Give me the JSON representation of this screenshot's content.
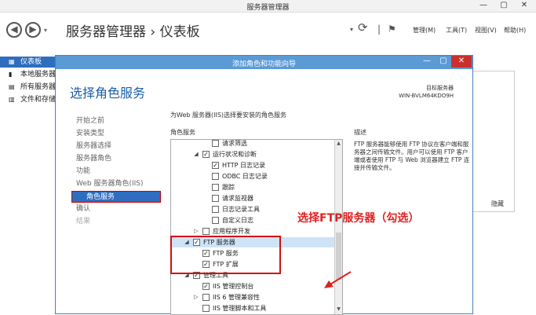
{
  "window": {
    "title": "服务器管理器",
    "min": "—",
    "max": "▢",
    "close": "✕"
  },
  "header": {
    "back": "◀",
    "forward": "▶",
    "dropdown": "▾",
    "breadcrumb": "服务器管理器 › 仪表板",
    "refresh_dd": "▾",
    "refresh": "⟳",
    "divider": "|",
    "flag": "⚑",
    "menus": [
      "管理(M)",
      "工具(T)",
      "视图(V)",
      "帮助(H)"
    ]
  },
  "sidebar": {
    "items": [
      {
        "label": "仪表板",
        "icon": "dashboard-icon",
        "glyph": "▦",
        "active": true
      },
      {
        "label": "本地服务器",
        "icon": "server-icon",
        "glyph": "▮",
        "active": false
      },
      {
        "label": "所有服务器",
        "icon": "servers-icon",
        "glyph": "▤",
        "active": false
      },
      {
        "label": "文件和存储",
        "icon": "storage-icon",
        "glyph": "▥",
        "active": false
      }
    ]
  },
  "bg": {
    "hide": "隐藏"
  },
  "dialog": {
    "title": "添加角色和功能向导",
    "btn_min": "—",
    "btn_max": "▢",
    "btn_close": "✕",
    "heading": "选择角色服务",
    "target_label": "目标服务器",
    "target_value": "WIN-BVLM64KDO9H",
    "steps": [
      {
        "label": "开始之前",
        "state": "normal"
      },
      {
        "label": "安装类型",
        "state": "normal"
      },
      {
        "label": "服务器选择",
        "state": "normal"
      },
      {
        "label": "服务器角色",
        "state": "normal"
      },
      {
        "label": "功能",
        "state": "normal"
      },
      {
        "label": "Web 服务器角色(IIS)",
        "state": "normal"
      },
      {
        "label": "角色服务",
        "state": "active"
      },
      {
        "label": "确认",
        "state": "normal"
      },
      {
        "label": "结果",
        "state": "dim"
      }
    ],
    "intro": "为Web 服务器(IIS)选择要安装的角色服务",
    "roles_label": "角色服务",
    "desc_label": "描述",
    "desc_text": "FTP 服务器能够使用 FTP 协议在客户端和服务器之间传输文件。用户可以使用 FTP 客户端或者使用 FTP 与 Web 浏览器建立 FTP 连接并传输文件。",
    "tree": [
      {
        "label": "请求筛选",
        "indent": 3,
        "exp": "",
        "checked": false,
        "partial": true
      },
      {
        "label": "运行状况和诊断",
        "indent": 2,
        "exp": "◢",
        "checked": true
      },
      {
        "label": "HTTP 日志记录",
        "indent": 3,
        "exp": "",
        "checked": true
      },
      {
        "label": "ODBC 日志记录",
        "indent": 3,
        "exp": "",
        "checked": false
      },
      {
        "label": "跟踪",
        "indent": 3,
        "exp": "",
        "checked": false
      },
      {
        "label": "请求监视器",
        "indent": 3,
        "exp": "",
        "checked": false
      },
      {
        "label": "日志记录工具",
        "indent": 3,
        "exp": "",
        "checked": false
      },
      {
        "label": "自定义日志",
        "indent": 3,
        "exp": "",
        "checked": false
      },
      {
        "label": "应用程序开发",
        "indent": 2,
        "exp": "▷",
        "checked": false
      },
      {
        "label": "FTP 服务器",
        "indent": 1,
        "exp": "◢",
        "checked": true,
        "hl": true
      },
      {
        "label": "FTP 服务",
        "indent": 2,
        "exp": "",
        "checked": true
      },
      {
        "label": "FTP 扩展",
        "indent": 2,
        "exp": "",
        "checked": true
      },
      {
        "label": "管理工具",
        "indent": 1,
        "exp": "◢",
        "checked": true
      },
      {
        "label": "IIS 管理控制台",
        "indent": 2,
        "exp": "",
        "checked": true
      },
      {
        "label": "IIS 6 管理兼容性",
        "indent": 2,
        "exp": "▷",
        "checked": false
      },
      {
        "label": "IIS 管理脚本和工具",
        "indent": 2,
        "exp": "",
        "checked": false
      }
    ],
    "annotation": "选择FTP服务器（勾选）"
  },
  "colors": {
    "accent": "#2f6dbf",
    "title": "#5b9bd5",
    "annotation": "#e02020"
  }
}
